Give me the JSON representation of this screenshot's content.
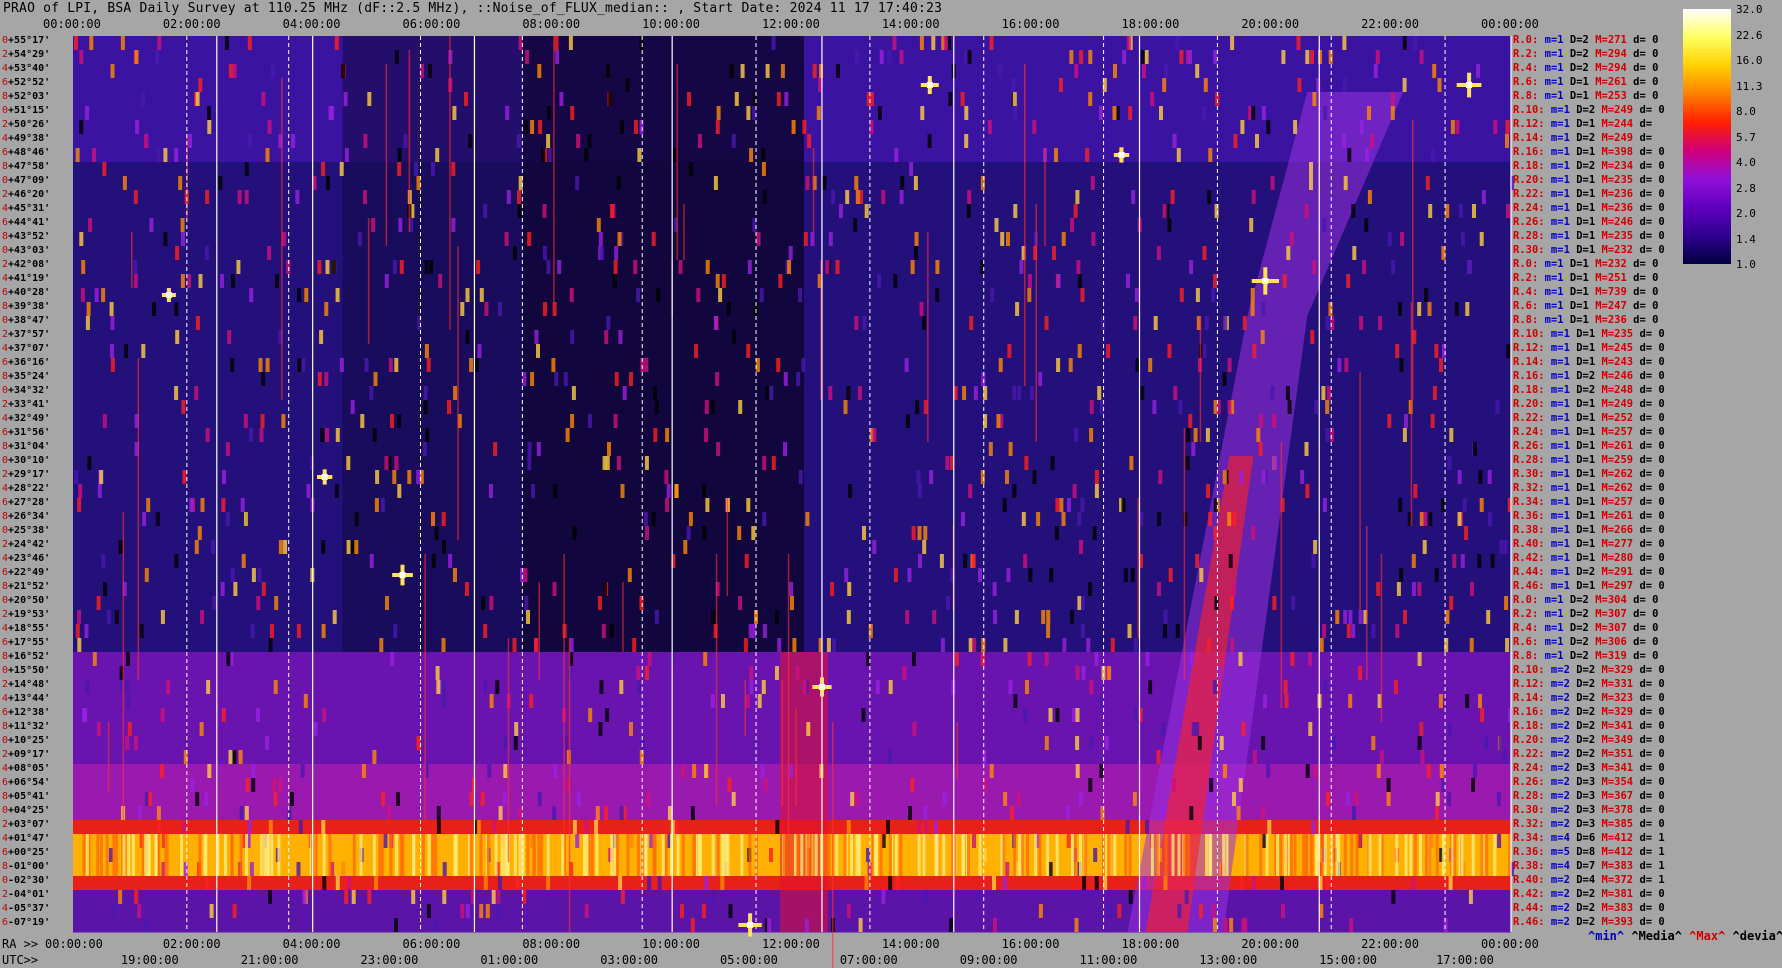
{
  "header": {
    "title": "PRAO of LPI, BSA Daily Survey at 110.25 MHz (dF::2.5 MHz), ::Noise_of_FLUX_median:: , Start Date: 2024 11 17 17:40:23"
  },
  "chart_data": {
    "type": "heatmap",
    "title": "PRAO of LPI, BSA Daily Survey at 110.25 MHz (dF::2.5 MHz), ::Noise_of_FLUX_median:: , Start Date: 2024 11 17 17:40:23",
    "top_axis_ticks": [
      "00:00:00",
      "02:00:00",
      "04:00:00",
      "06:00:00",
      "08:00:00",
      "10:00:00",
      "12:00:00",
      "14:00:00",
      "16:00:00",
      "18:00:00",
      "20:00:00",
      "22:00:00",
      "00:00:00"
    ],
    "bottom_axis_prefix": [
      "RA >>",
      "UTC>>"
    ],
    "bottom_ra_ticks": [
      "00:00:00",
      "02:00:00",
      "04:00:00",
      "06:00:00",
      "08:00:00",
      "10:00:00",
      "12:00:00",
      "14:00:00",
      "16:00:00",
      "18:00:00",
      "20:00:00",
      "22:00:00",
      "00:00:00"
    ],
    "bottom_utc_ticks": [
      "19:00:00",
      "21:00:00",
      "23:00:00",
      "01:00:00",
      "03:00:00",
      "05:00:00",
      "07:00:00",
      "09:00:00",
      "11:00:00",
      "13:00:00",
      "15:00:00",
      "17:00:00"
    ],
    "declination_labels": [
      "+55°17'",
      "+54°29'",
      "+53°40'",
      "+52°52'",
      "+52°03'",
      "+51°15'",
      "+50°26'",
      "+49°38'",
      "+48°46'",
      "+47°58'",
      "+47°09'",
      "+46°20'",
      "+45°31'",
      "+44°41'",
      "+43°52'",
      "+43°03'",
      "+42°08'",
      "+41°19'",
      "+40°28'",
      "+39°38'",
      "+38°47'",
      "+37°57'",
      "+37°07'",
      "+36°16'",
      "+35°24'",
      "+34°32'",
      "+33°41'",
      "+32°49'",
      "+31°56'",
      "+31°04'",
      "+30°10'",
      "+29°17'",
      "+28°22'",
      "+27°28'",
      "+26°34'",
      "+25°38'",
      "+24°42'",
      "+23°46'",
      "+22°49'",
      "+21°52'",
      "+20°50'",
      "+19°53'",
      "+18°55'",
      "+17°55'",
      "+16°52'",
      "+15°50'",
      "+14°48'",
      "+13°44'",
      "+12°38'",
      "+11°32'",
      "+10°25'",
      "+09°17'",
      "+08°05'",
      "+06°54'",
      "+05°41'",
      "+04°25'",
      "+03°07'",
      "+01°47'",
      "+00°25'",
      "-01°00'",
      "-02°30'",
      "-04°01'",
      "-05°37'",
      "-07°19'"
    ],
    "declination_index": [
      "0",
      "2",
      "4",
      "6",
      "8",
      "0",
      "2",
      "4",
      "6",
      "8",
      "0",
      "2",
      "4",
      "6",
      "8",
      "0",
      "2",
      "4",
      "6",
      "8",
      "0",
      "2",
      "4",
      "6",
      "8",
      "0",
      "2",
      "4",
      "6",
      "8",
      "0",
      "2",
      "4",
      "6",
      "8",
      "0",
      "2",
      "4",
      "6",
      "8",
      "0",
      "2",
      "4",
      "6",
      "8",
      "0",
      "2",
      "4",
      "6",
      "8",
      "0",
      "2",
      "4",
      "6",
      "8",
      "0",
      "2",
      "4",
      "6",
      "8",
      "0",
      "2",
      "4",
      "6"
    ],
    "stats_rows": [
      {
        "r": "R.0:",
        "m": "m=1",
        "d": "D=2",
        "h": "M=271",
        "dd": "d= 0"
      },
      {
        "r": "R.2:",
        "m": "m=1",
        "d": "D=2",
        "h": "M=294",
        "dd": "d= 0"
      },
      {
        "r": "R.4:",
        "m": "m=1",
        "d": "D=2",
        "h": "M=294",
        "dd": "d= 0"
      },
      {
        "r": "R.6:",
        "m": "m=1",
        "d": "D=1",
        "h": "M=261",
        "dd": "d= 0"
      },
      {
        "r": "R.8:",
        "m": "m=1",
        "d": "D=1",
        "h": "M=253",
        "dd": "d= 0"
      },
      {
        "r": "R.10:",
        "m": "m=1",
        "d": "D=2",
        "h": "M=249",
        "dd": "d= 0"
      },
      {
        "r": "R.12:",
        "m": "m=1",
        "d": "D=1",
        "h": "M=244",
        "dd": "d= "
      },
      {
        "r": "R.14:",
        "m": "m=1",
        "d": "D=2",
        "h": "M=249",
        "dd": "d= "
      },
      {
        "r": "R.16:",
        "m": "m=1",
        "d": "D=1",
        "h": "M=398",
        "dd": "d= 0"
      },
      {
        "r": "R.18:",
        "m": "m=1",
        "d": "D=2",
        "h": "M=234",
        "dd": "d= 0"
      },
      {
        "r": "R.20:",
        "m": "m=1",
        "d": "D=1",
        "h": "M=235",
        "dd": "d= 0"
      },
      {
        "r": "R.22:",
        "m": "m=1",
        "d": "D=1",
        "h": "M=236",
        "dd": "d= 0"
      },
      {
        "r": "R.24:",
        "m": "m=1",
        "d": "D=1",
        "h": "M=236",
        "dd": "d= 0"
      },
      {
        "r": "R.26:",
        "m": "m=1",
        "d": "D=1",
        "h": "M=246",
        "dd": "d= 0"
      },
      {
        "r": "R.28:",
        "m": "m=1",
        "d": "D=1",
        "h": "M=235",
        "dd": "d= 0"
      },
      {
        "r": "R.30:",
        "m": "m=1",
        "d": "D=1",
        "h": "M=232",
        "dd": "d= 0"
      },
      {
        "r": "R.0:",
        "m": "m=1",
        "d": "D=1",
        "h": "M=232",
        "dd": "d= 0"
      },
      {
        "r": "R.2:",
        "m": "m=1",
        "d": "D=1",
        "h": "M=251",
        "dd": "d= 0"
      },
      {
        "r": "R.4:",
        "m": "m=1",
        "d": "D=1",
        "h": "M=739",
        "dd": "d= 0"
      },
      {
        "r": "R.6:",
        "m": "m=1",
        "d": "D=1",
        "h": "M=247",
        "dd": "d= 0"
      },
      {
        "r": "R.8:",
        "m": "m=1",
        "d": "D=1",
        "h": "M=236",
        "dd": "d= 0"
      },
      {
        "r": "R.10:",
        "m": "m=1",
        "d": "D=1",
        "h": "M=235",
        "dd": "d= 0"
      },
      {
        "r": "R.12:",
        "m": "m=1",
        "d": "D=1",
        "h": "M=245",
        "dd": "d= 0"
      },
      {
        "r": "R.14:",
        "m": "m=1",
        "d": "D=1",
        "h": "M=243",
        "dd": "d= 0"
      },
      {
        "r": "R.16:",
        "m": "m=1",
        "d": "D=2",
        "h": "M=246",
        "dd": "d= 0"
      },
      {
        "r": "R.18:",
        "m": "m=1",
        "d": "D=2",
        "h": "M=248",
        "dd": "d= 0"
      },
      {
        "r": "R.20:",
        "m": "m=1",
        "d": "D=1",
        "h": "M=249",
        "dd": "d= 0"
      },
      {
        "r": "R.22:",
        "m": "m=1",
        "d": "D=1",
        "h": "M=252",
        "dd": "d= 0"
      },
      {
        "r": "R.24:",
        "m": "m=1",
        "d": "D=1",
        "h": "M=257",
        "dd": "d= 0"
      },
      {
        "r": "R.26:",
        "m": "m=1",
        "d": "D=1",
        "h": "M=261",
        "dd": "d= 0"
      },
      {
        "r": "R.28:",
        "m": "m=1",
        "d": "D=1",
        "h": "M=259",
        "dd": "d= 0"
      },
      {
        "r": "R.30:",
        "m": "m=1",
        "d": "D=1",
        "h": "M=262",
        "dd": "d= 0"
      },
      {
        "r": "R.32:",
        "m": "m=1",
        "d": "D=1",
        "h": "M=262",
        "dd": "d= 0"
      },
      {
        "r": "R.34:",
        "m": "m=1",
        "d": "D=1",
        "h": "M=257",
        "dd": "d= 0"
      },
      {
        "r": "R.36:",
        "m": "m=1",
        "d": "D=1",
        "h": "M=261",
        "dd": "d= 0"
      },
      {
        "r": "R.38:",
        "m": "m=1",
        "d": "D=1",
        "h": "M=266",
        "dd": "d= 0"
      },
      {
        "r": "R.40:",
        "m": "m=1",
        "d": "D=1",
        "h": "M=277",
        "dd": "d= 0"
      },
      {
        "r": "R.42:",
        "m": "m=1",
        "d": "D=1",
        "h": "M=280",
        "dd": "d= 0"
      },
      {
        "r": "R.44:",
        "m": "m=1",
        "d": "D=2",
        "h": "M=291",
        "dd": "d= 0"
      },
      {
        "r": "R.46:",
        "m": "m=1",
        "d": "D=1",
        "h": "M=297",
        "dd": "d= 0"
      },
      {
        "r": "R.0:",
        "m": "m=1",
        "d": "D=2",
        "h": "M=304",
        "dd": "d= 0"
      },
      {
        "r": "R.2:",
        "m": "m=1",
        "d": "D=2",
        "h": "M=307",
        "dd": "d= 0"
      },
      {
        "r": "R.4:",
        "m": "m=1",
        "d": "D=2",
        "h": "M=307",
        "dd": "d= 0"
      },
      {
        "r": "R.6:",
        "m": "m=1",
        "d": "D=2",
        "h": "M=306",
        "dd": "d= 0"
      },
      {
        "r": "R.8:",
        "m": "m=1",
        "d": "D=2",
        "h": "M=319",
        "dd": "d= 0"
      },
      {
        "r": "R.10:",
        "m": "m=2",
        "d": "D=2",
        "h": "M=329",
        "dd": "d= 0"
      },
      {
        "r": "R.12:",
        "m": "m=2",
        "d": "D=2",
        "h": "M=331",
        "dd": "d= 0"
      },
      {
        "r": "R.14:",
        "m": "m=2",
        "d": "D=2",
        "h": "M=323",
        "dd": "d= 0"
      },
      {
        "r": "R.16:",
        "m": "m=2",
        "d": "D=2",
        "h": "M=329",
        "dd": "d= 0"
      },
      {
        "r": "R.18:",
        "m": "m=2",
        "d": "D=2",
        "h": "M=341",
        "dd": "d= 0"
      },
      {
        "r": "R.20:",
        "m": "m=2",
        "d": "D=2",
        "h": "M=349",
        "dd": "d= 0"
      },
      {
        "r": "R.22:",
        "m": "m=2",
        "d": "D=2",
        "h": "M=351",
        "dd": "d= 0"
      },
      {
        "r": "R.24:",
        "m": "m=2",
        "d": "D=3",
        "h": "M=341",
        "dd": "d= 0"
      },
      {
        "r": "R.26:",
        "m": "m=2",
        "d": "D=3",
        "h": "M=354",
        "dd": "d= 0"
      },
      {
        "r": "R.28:",
        "m": "m=2",
        "d": "D=3",
        "h": "M=367",
        "dd": "d= 0"
      },
      {
        "r": "R.30:",
        "m": "m=2",
        "d": "D=3",
        "h": "M=378",
        "dd": "d= 0"
      },
      {
        "r": "R.32:",
        "m": "m=2",
        "d": "D=3",
        "h": "M=385",
        "dd": "d= 0"
      },
      {
        "r": "R.34:",
        "m": "m=4",
        "d": "D=6",
        "h": "M=412",
        "dd": "d= 1"
      },
      {
        "r": "R.36:",
        "m": "m=5",
        "d": "D=8",
        "h": "M=412",
        "dd": "d= 1"
      },
      {
        "r": "R.38:",
        "m": "m=4",
        "d": "D=7",
        "h": "M=383",
        "dd": "d= 1"
      },
      {
        "r": "R.40:",
        "m": "m=2",
        "d": "D=4",
        "h": "M=372",
        "dd": "d= 1"
      },
      {
        "r": "R.42:",
        "m": "m=2",
        "d": "D=2",
        "h": "M=381",
        "dd": "d= 0"
      },
      {
        "r": "R.44:",
        "m": "m=2",
        "d": "D=2",
        "h": "M=383",
        "dd": "d= 0"
      },
      {
        "r": "R.46:",
        "m": "m=2",
        "d": "D=2",
        "h": "M=393",
        "dd": "d= 0"
      }
    ],
    "colorbar_labels": [
      "32.0",
      "22.6",
      "16.0",
      "11.3",
      "8.0",
      "5.7",
      "4.0",
      "2.8",
      "2.0",
      "1.4",
      "1.0"
    ],
    "colorbar_colors": [
      "#ffffff",
      "#ffff60",
      "#ffd000",
      "#ff8000",
      "#ff2000",
      "#d0007a",
      "#9010d8",
      "#6000c0",
      "#300090",
      "#000040"
    ],
    "legend": {
      "min": "^min^",
      "median": "^Media^",
      "max": "^Max^",
      "devia": "^devia^"
    },
    "legend_colors": {
      "min": "#0000c0",
      "median": "#000000",
      "max": "#d00000",
      "devia": "#000000"
    },
    "solid_vline_hours": [
      2.4,
      4.0,
      6.7,
      10.0,
      12.5,
      14.7,
      17.8,
      20.8,
      24.0
    ],
    "dashed_vline_hours": [
      1.9,
      3.6,
      5.8,
      7.5,
      9.5,
      11.4,
      13.3,
      15.2,
      17.2,
      19.1,
      21.0,
      22.9
    ],
    "bright_sources": [
      {
        "ra_h": 19.9,
        "row": 17,
        "level": 32
      },
      {
        "ra_h": 23.3,
        "row": 3,
        "level": 28
      },
      {
        "ra_h": 5.5,
        "row": 38,
        "level": 22
      },
      {
        "ra_h": 12.5,
        "row": 46,
        "level": 20
      },
      {
        "ra_h": 11.3,
        "row": 63,
        "level": 26
      },
      {
        "ra_h": 14.3,
        "row": 3,
        "level": 18
      },
      {
        "ra_h": 17.5,
        "row": 8,
        "level": 14
      },
      {
        "ra_h": 4.2,
        "row": 31,
        "level": 14
      },
      {
        "ra_h": 1.6,
        "row": 18,
        "level": 12
      }
    ]
  }
}
